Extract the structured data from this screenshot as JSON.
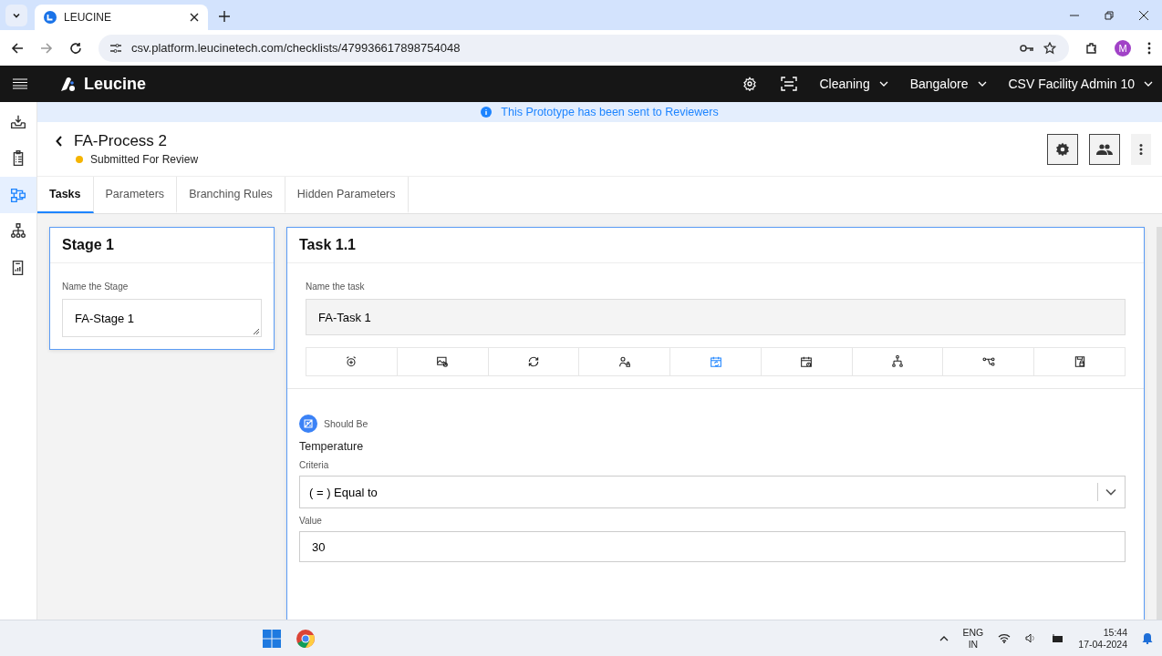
{
  "browser": {
    "tab_title": "LEUCINE",
    "url": "csv.platform.leucinetech.com/checklists/479936617898754048",
    "profile_initial": "M"
  },
  "app_header": {
    "logo": "Leucine",
    "dropdowns": [
      {
        "label": "Cleaning"
      },
      {
        "label": "Bangalore"
      },
      {
        "label": "CSV Facility Admin 10"
      }
    ]
  },
  "sidebar": {
    "items": [
      {
        "kind": "inbox",
        "selected": false
      },
      {
        "kind": "checklist",
        "selected": false
      },
      {
        "kind": "process",
        "selected": true
      },
      {
        "kind": "hierarchy",
        "selected": false
      },
      {
        "kind": "reports",
        "selected": false
      }
    ]
  },
  "banner": "This Prototype has been sent to Reviewers",
  "page": {
    "title": "FA-Process 2",
    "status": "Submitted For Review",
    "in_review": true
  },
  "tabs": [
    {
      "label": "Tasks",
      "selected": true
    },
    {
      "label": "Parameters",
      "selected": false
    },
    {
      "label": "Branching Rules",
      "selected": false
    },
    {
      "label": "Hidden Parameters",
      "selected": false
    }
  ],
  "stage": {
    "title": "Stage 1",
    "field_label": "Name the Stage",
    "value": "FA-Stage 1"
  },
  "task": {
    "title": "Task 1.1",
    "field_label": "Name the task",
    "value": "FA-Task 1",
    "toolbar": [
      {
        "kind": "alarm",
        "selected": false
      },
      {
        "kind": "image",
        "selected": false
      },
      {
        "kind": "recurrence",
        "selected": false
      },
      {
        "kind": "user-lock",
        "selected": false
      },
      {
        "kind": "calendar-sync",
        "selected": true
      },
      {
        "kind": "calendar-clock",
        "selected": false
      },
      {
        "kind": "hierarchy",
        "selected": false
      },
      {
        "kind": "branch",
        "selected": false
      },
      {
        "kind": "lock-file",
        "selected": false
      }
    ],
    "parameter": {
      "type_label": "Should Be",
      "name": "Temperature",
      "criteria_label": "Criteria",
      "criteria": "( = ) Equal to",
      "value_label": "Value",
      "value": "30"
    }
  },
  "taskbar": {
    "language": "ENG",
    "region": "IN",
    "time": "15:44",
    "date": "17-04-2024"
  }
}
